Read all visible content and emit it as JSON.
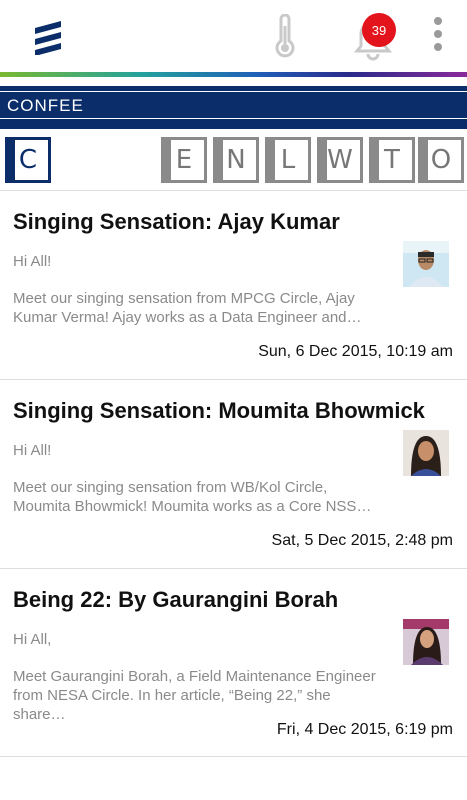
{
  "header": {
    "notifications_count": "39",
    "brand_icon": "ericsson-logo-icon",
    "colors": {
      "banner": "#0b2e6b",
      "badge": "#e3141b"
    }
  },
  "banner": {
    "title": "CONFEE"
  },
  "tiles": [
    "C",
    "E",
    "N",
    "L",
    "W",
    "T",
    "O"
  ],
  "posts": [
    {
      "title": "Singing Sensation: Ajay Kumar",
      "greeting": "Hi All!",
      "excerpt": "Meet our singing sensation from MPCG Circle, Ajay Kumar Verma! Ajay works as a Data Engineer and…",
      "date": "Sun, 6 Dec 2015, 10:19 am"
    },
    {
      "title": "Singing Sensation: Moumita Bhowmick",
      "greeting": "Hi All!",
      "excerpt": "Meet our singing sensation from WB/Kol Circle, Moumita Bhowmick! Moumita works as a Core NSS…",
      "date": "Sat, 5 Dec 2015, 2:48 pm"
    },
    {
      "title": "Being 22: By Gaurangini Borah",
      "greeting": "Hi All,",
      "excerpt": "Meet Gaurangini Borah, a Field Maintenance Engineer from NESA Circle. In her article, “Being 22,” she share…",
      "date": "Fri, 4 Dec 2015, 6:19 pm"
    }
  ]
}
